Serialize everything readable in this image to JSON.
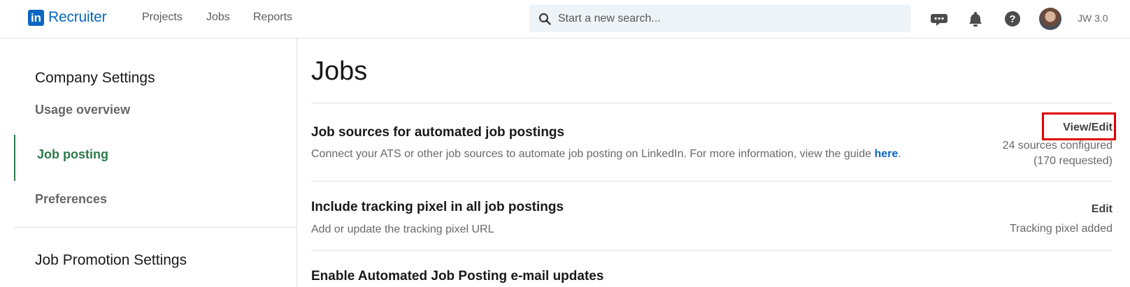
{
  "brand": {
    "logo_letters": "in",
    "product": "Recruiter",
    "color": "#0a66c2"
  },
  "nav": {
    "projects": "Projects",
    "jobs": "Jobs",
    "reports": "Reports"
  },
  "search": {
    "placeholder": "Start a new search..."
  },
  "header_icons": [
    "messaging-icon",
    "notifications-bell-icon",
    "help-icon"
  ],
  "user": {
    "label": "JW 3.0"
  },
  "sidebar": {
    "company_heading": "Company Settings",
    "items": [
      {
        "label": "Usage overview",
        "active": false
      },
      {
        "label": "Job posting",
        "active": true
      },
      {
        "label": "Preferences",
        "active": false
      }
    ],
    "promotion_heading": "Job Promotion Settings",
    "active_color": "#2d7a49"
  },
  "main": {
    "title": "Jobs",
    "rows": [
      {
        "title": "Job sources for automated job postings",
        "description": "Connect your ATS or other job sources to automate job posting on LinkedIn. For more information, view the guide ",
        "link": "here",
        "link_suffix": ".",
        "action": "View/Edit",
        "meta_line1": "24 sources configured",
        "meta_line2": "(170 requested)",
        "highlight_color": "#e00000"
      },
      {
        "title": "Include tracking pixel in all job postings",
        "description": "Add or update the tracking pixel URL",
        "action": "Edit",
        "meta_line1": "Tracking pixel added"
      },
      {
        "title": "Enable Automated Job Posting e-mail updates"
      }
    ]
  }
}
